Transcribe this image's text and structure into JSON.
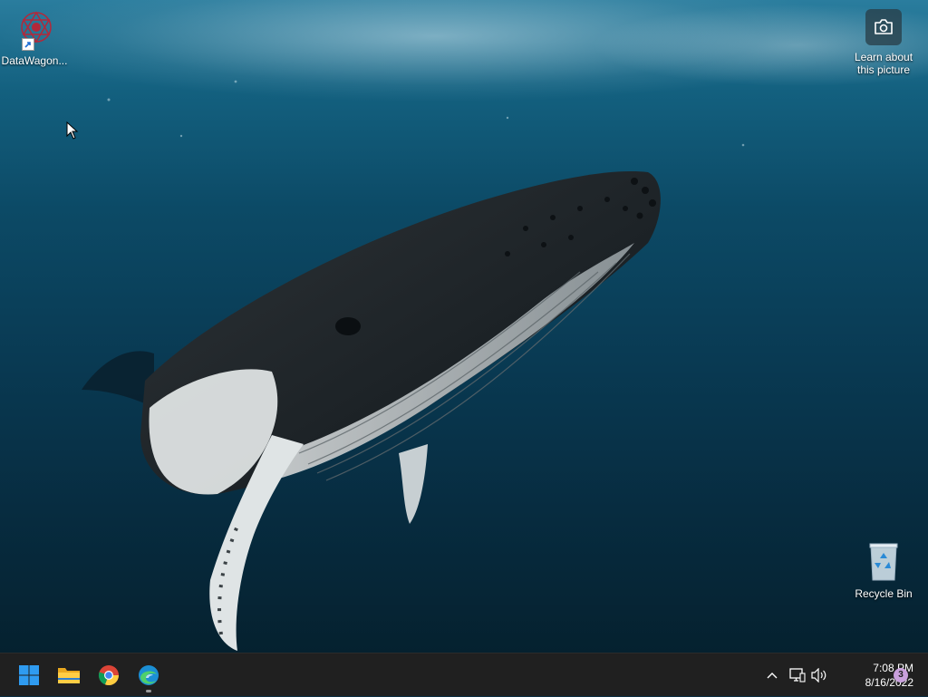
{
  "desktop": {
    "icons": [
      {
        "label": "DataWagon...",
        "icon": "datawagon-shortcut-icon"
      },
      {
        "label": "Recycle Bin",
        "icon": "recycle-bin-icon"
      }
    ],
    "learn_picture": {
      "line1": "Learn about",
      "line2": "this picture",
      "icon": "camera-icon"
    }
  },
  "taskbar": {
    "apps": [
      {
        "name": "Start",
        "icon": "windows-start-icon"
      },
      {
        "name": "File Explorer",
        "icon": "folder-icon"
      },
      {
        "name": "Google Chrome",
        "icon": "chrome-icon"
      },
      {
        "name": "Microsoft Edge",
        "icon": "edge-icon"
      }
    ],
    "tray": {
      "time": "7:08 PM",
      "date": "8/16/2022",
      "notifications": "3"
    }
  },
  "colors": {
    "taskbar": "#202020",
    "start_blue": "#2f9bf0",
    "badge": "#c9a0dc"
  }
}
